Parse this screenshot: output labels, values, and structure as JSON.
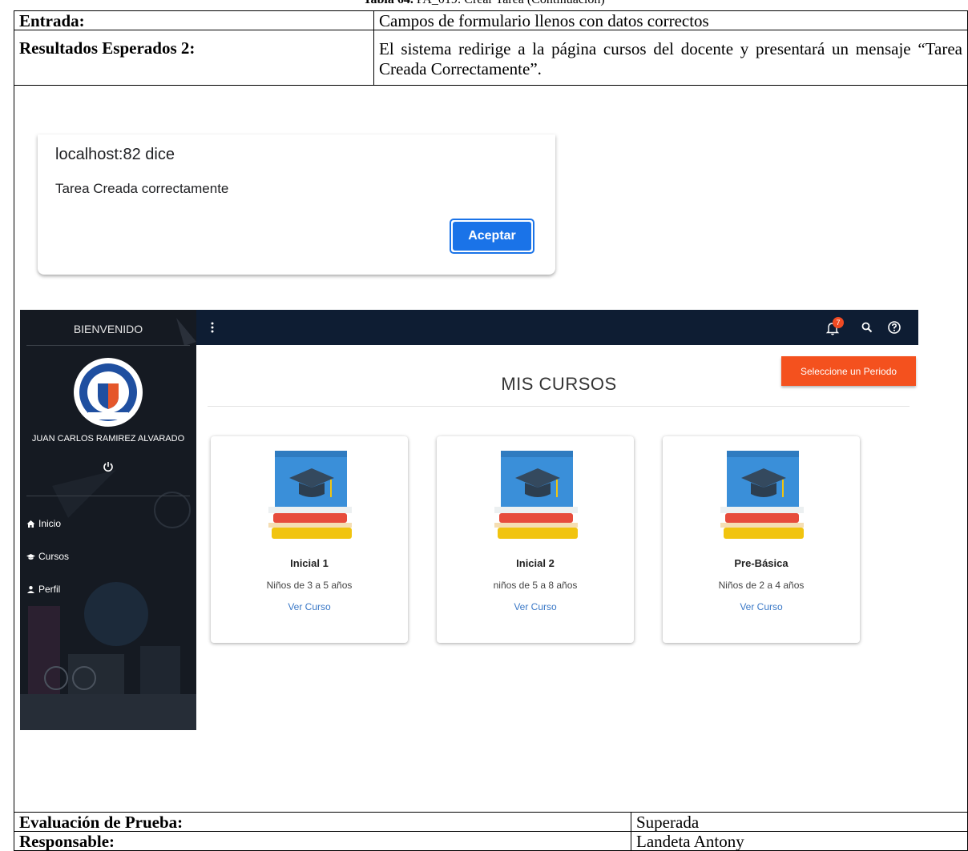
{
  "caption": {
    "label": "Tabla 64.",
    "text": " PA_019: Crear Tarea (Continuación)"
  },
  "table": {
    "entrada_label": "Entrada:",
    "entrada_value": "Campos de formulario llenos con datos correctos",
    "resultados_label": "Resultados Esperados 2:",
    "resultados_value": "El sistema redirige a la página cursos del docente y presentará un mensaje “Tarea Creada Correctamente”.",
    "evaluacion_label": "Evaluación de Prueba:",
    "evaluacion_value": "Superada",
    "responsable_label": "Responsable:",
    "responsable_value": "Landeta Antony"
  },
  "dialog": {
    "title": "localhost:82 dice",
    "message": "Tarea Creada correctamente",
    "accept_label": "Aceptar",
    "accent": "#1a73e8"
  },
  "app": {
    "sidebar": {
      "title": "BIENVENIDO",
      "user": "JUAN CARLOS RAMIREZ ALVARADO",
      "items": [
        {
          "label": "Inicio",
          "icon": "home-icon"
        },
        {
          "label": "Cursos",
          "icon": "graduation-cap-icon"
        },
        {
          "label": "Perfil",
          "icon": "user-icon"
        }
      ]
    },
    "topbar": {
      "notification_count": "7",
      "bar_color": "#0e1d33"
    },
    "period_button": "Seleccione un Periodo",
    "page_title": "MIS CURSOS",
    "courses": [
      {
        "name": "Inicial 1",
        "description": "Niños de 3 a 5 años",
        "link": "Ver Curso"
      },
      {
        "name": "Inicial 2",
        "description": "niños de 5 a 8 años",
        "link": "Ver Curso"
      },
      {
        "name": "Pre-Básica",
        "description": "Niños de 2 a 4 años",
        "link": "Ver Curso"
      }
    ],
    "accent_orange": "#f4511e"
  }
}
